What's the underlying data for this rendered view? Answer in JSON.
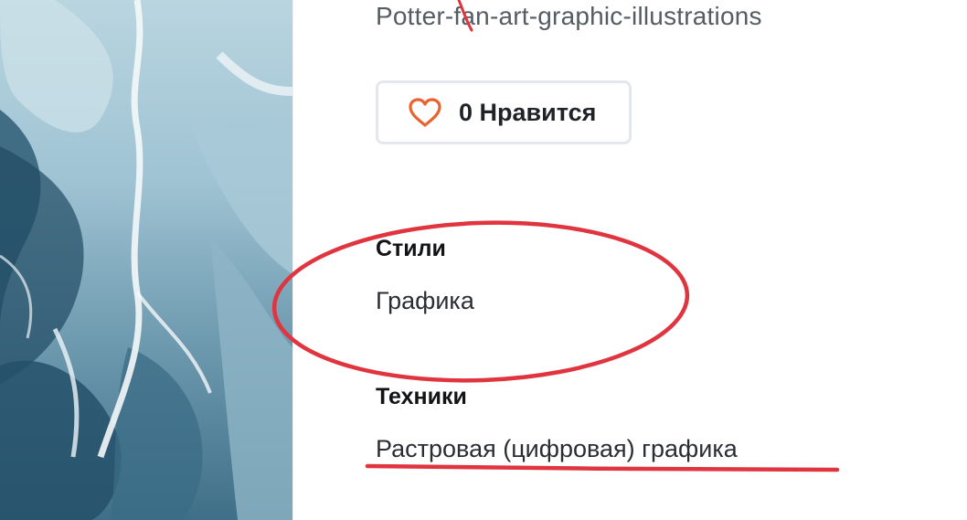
{
  "artwork": {
    "icon": "watercolor-artwork"
  },
  "tags_line": "Potter-fan-art-graphic-illustrations",
  "like": {
    "count_label": "0 Нравится",
    "icon": "heart-icon",
    "icon_color": "#e8632e"
  },
  "styles": {
    "heading": "Стили",
    "value": "Графика"
  },
  "techniques": {
    "heading": "Техники",
    "value": "Растровая (цифровая) графика"
  },
  "annotation_color": "#e0343f"
}
